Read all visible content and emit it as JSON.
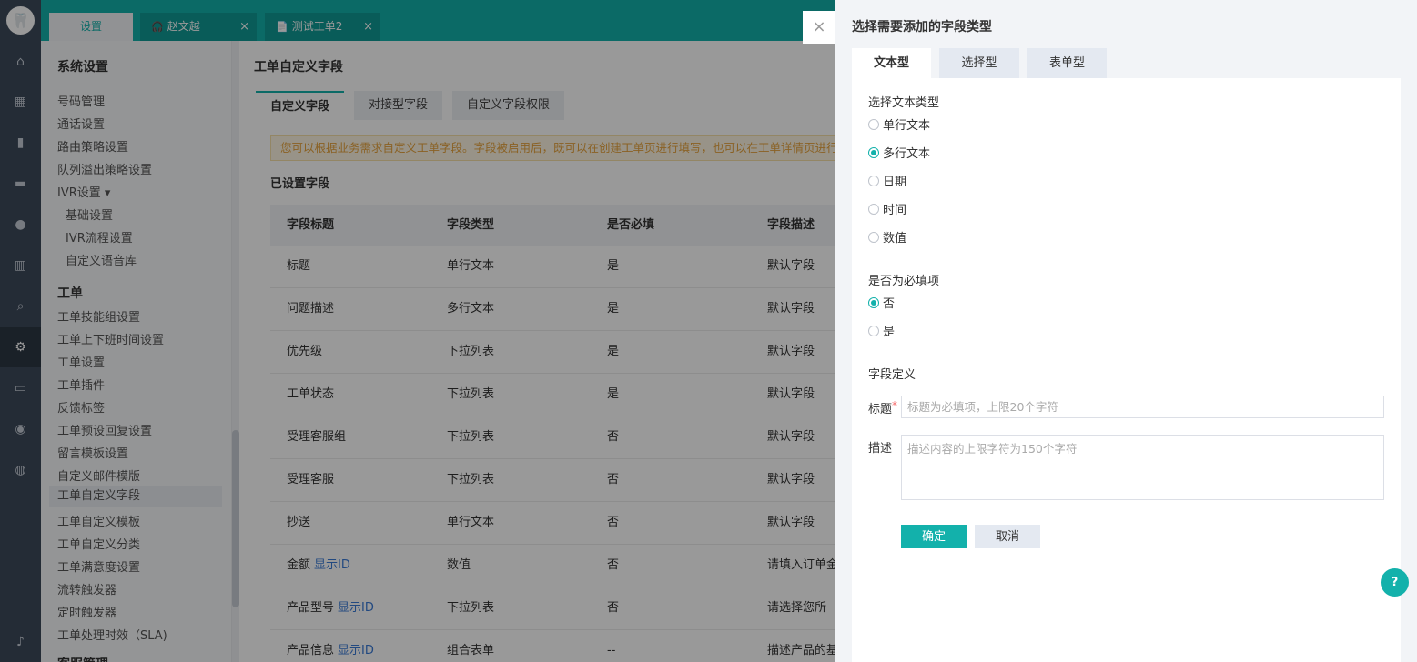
{
  "app": {
    "logo": "🦷"
  },
  "rail_icons": [
    "home-icon",
    "grid-icon",
    "book-icon",
    "chat-icon",
    "user-icon",
    "chart-icon",
    "search-icon",
    "gear-icon",
    "monitor-icon",
    "tooth-icon",
    "account-icon",
    "bell-icon"
  ],
  "tabs": [
    {
      "label": "设置",
      "active": true
    },
    {
      "label": "赵文越",
      "icon": "🎧",
      "close": "×"
    },
    {
      "label": "测试工单2",
      "icon": "📄",
      "close": "×"
    }
  ],
  "sidebar": {
    "section1": "系统设置",
    "items1": [
      "号码管理",
      "通话设置",
      "路由策略设置",
      "队列溢出策略设置",
      "IVR设置 ▾"
    ],
    "ivr_sub": [
      "基础设置",
      "IVR流程设置",
      "自定义语音库"
    ],
    "section2": "工单",
    "items2": [
      "工单技能组设置",
      "工单上下班时间设置",
      "工单设置",
      "工单插件",
      "反馈标签",
      "工单预设回复设置",
      "留言模板设置",
      "自定义邮件模版",
      "工单自定义字段",
      "工单自定义模板",
      "工单自定义分类",
      "工单满意度设置",
      "流转触发器",
      "定时触发器",
      "工单处理时效（SLA)"
    ],
    "selected": "工单自定义字段",
    "section3_partial": "客服管理"
  },
  "main": {
    "title": "工单自定义字段",
    "tabs": [
      "自定义字段",
      "对接型字段",
      "自定义字段权限"
    ],
    "tip": "您可以根据业务需求自定义工单字段。字段被启用后，既可以在创建工单页进行填写，也可以在工单详情页进行",
    "section": "已设置字段",
    "columns": [
      "字段标题",
      "字段类型",
      "是否必填",
      "字段描述"
    ],
    "rows": [
      {
        "title": "标题",
        "link": "",
        "type": "单行文本",
        "required": "是",
        "desc": "默认字段"
      },
      {
        "title": "问题描述",
        "link": "",
        "type": "多行文本",
        "required": "是",
        "desc": "默认字段"
      },
      {
        "title": "优先级",
        "link": "",
        "type": "下拉列表",
        "required": "是",
        "desc": "默认字段"
      },
      {
        "title": "工单状态",
        "link": "",
        "type": "下拉列表",
        "required": "是",
        "desc": "默认字段"
      },
      {
        "title": "受理客服组",
        "link": "",
        "type": "下拉列表",
        "required": "否",
        "desc": "默认字段"
      },
      {
        "title": "受理客服",
        "link": "",
        "type": "下拉列表",
        "required": "否",
        "desc": "默认字段"
      },
      {
        "title": "抄送",
        "link": "",
        "type": "单行文本",
        "required": "否",
        "desc": "默认字段"
      },
      {
        "title": "金额",
        "link": "显示ID",
        "type": "数值",
        "required": "否",
        "desc": "请填入订单金"
      },
      {
        "title": "产品型号",
        "link": "显示ID",
        "type": "下拉列表",
        "required": "否",
        "desc": "请选择您所"
      },
      {
        "title": "产品信息",
        "link": "显示ID",
        "type": "组合表单",
        "required": "--",
        "desc": "描述产品的基"
      }
    ]
  },
  "panel": {
    "close": "×",
    "title": "选择需要添加的字段类型",
    "tabs": [
      "文本型",
      "选择型",
      "表单型"
    ],
    "text_type_label": "选择文本类型",
    "text_types": [
      "单行文本",
      "多行文本",
      "日期",
      "时间",
      "数值"
    ],
    "text_type_selected": 1,
    "required_label": "是否为必填项",
    "required_options": [
      "否",
      "是"
    ],
    "required_selected": 0,
    "definition_label": "字段定义",
    "title_label": "标题",
    "required_mark": "*",
    "title_placeholder": "标题为必填项，上限20个字符",
    "desc_label": "描述",
    "desc_placeholder": "描述内容的上限字符为150个字符",
    "ok": "确定",
    "cancel": "取消"
  },
  "help": "?"
}
